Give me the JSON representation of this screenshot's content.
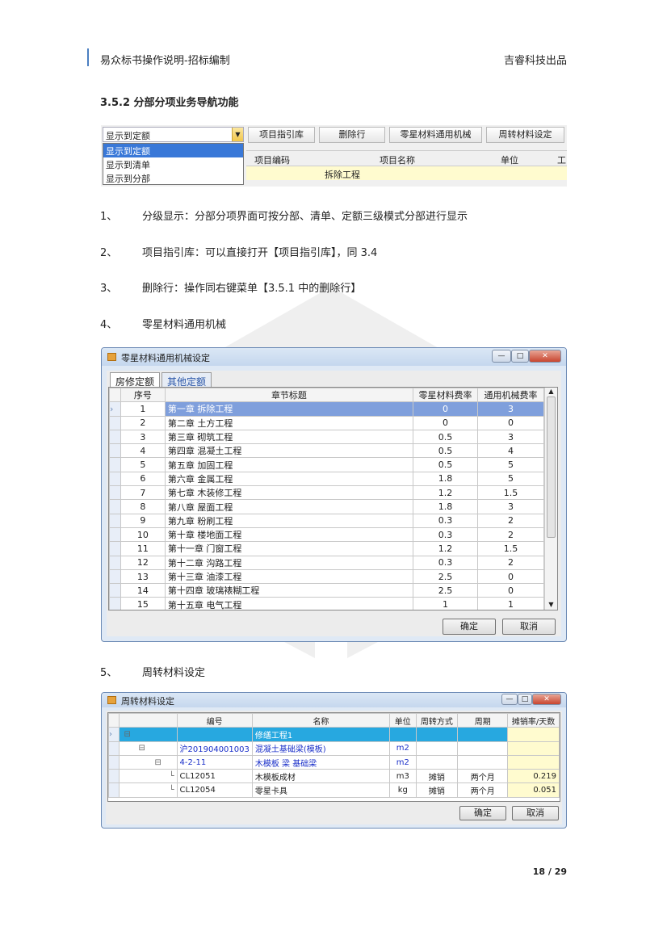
{
  "header": {
    "left": "易众标书操作说明-招标编制",
    "right": "吉睿科技出品"
  },
  "section_title": "3.5.2 分部分项业务导航功能",
  "toolbar": {
    "combo_value": "显示到定额",
    "dropdown": [
      "显示到定额",
      "显示到清单",
      "显示到分部"
    ],
    "buttons": [
      "项目指引库",
      "删除行",
      "零星材料通用机械",
      "周转材料设定"
    ],
    "headers": [
      "项目编码",
      "项目名称",
      "单位",
      "工"
    ],
    "row_name": "拆除工程"
  },
  "items": [
    {
      "n": "1、",
      "text": "分级显示：分部分项界面可按分部、清单、定额三级模式分部进行显示"
    },
    {
      "n": "2、",
      "text": "项目指引库：可以直接打开【项目指引库】，同 3.4"
    },
    {
      "n": "3、",
      "text": "删除行：操作同右键菜单【3.5.1 中的删除行】"
    },
    {
      "n": "4、",
      "text": "零星材料通用机械"
    },
    {
      "n": "5、",
      "text": "周转材料设定"
    }
  ],
  "dialog1": {
    "title": "零星材料通用机械设定",
    "tabs": [
      "房修定额",
      "其他定额"
    ],
    "columns": [
      "序号",
      "章节标题",
      "零星材料费率",
      "通用机械费率"
    ],
    "rows": [
      [
        "1",
        "第一章 拆除工程",
        "0",
        "3"
      ],
      [
        "2",
        "第二章 土方工程",
        "0",
        "0"
      ],
      [
        "3",
        "第三章 砌筑工程",
        "0.5",
        "3"
      ],
      [
        "4",
        "第四章 混凝土工程",
        "0.5",
        "4"
      ],
      [
        "5",
        "第五章 加固工程",
        "0.5",
        "5"
      ],
      [
        "6",
        "第六章 金属工程",
        "1.8",
        "5"
      ],
      [
        "7",
        "第七章 木装修工程",
        "1.2",
        "1.5"
      ],
      [
        "8",
        "第八章 屋面工程",
        "1.8",
        "3"
      ],
      [
        "9",
        "第九章 粉刷工程",
        "0.3",
        "2"
      ],
      [
        "10",
        "第十章 楼地面工程",
        "0.3",
        "2"
      ],
      [
        "11",
        "第十一章 门窗工程",
        "1.2",
        "1.5"
      ],
      [
        "12",
        "第十二章 沟路工程",
        "0.3",
        "2"
      ],
      [
        "13",
        "第十三章 油漆工程",
        "2.5",
        "0"
      ],
      [
        "14",
        "第十四章 玻璃裱糊工程",
        "2.5",
        "0"
      ],
      [
        "15",
        "第十五章 电气工程",
        "1",
        "1"
      ]
    ],
    "ok": "确定",
    "cancel": "取消"
  },
  "dialog2": {
    "title": "周转材料设定",
    "columns": [
      "编号",
      "名称",
      "单位",
      "周转方式",
      "周期",
      "摊销率/天数"
    ],
    "rows": [
      [
        "",
        "修缮工程1",
        "",
        "",
        "",
        ""
      ],
      [
        "沪201904001003",
        "混凝土基础梁(模板)",
        "m2",
        "",
        "",
        ""
      ],
      [
        "4-2-11",
        "木模板 梁 基础梁",
        "m2",
        "",
        "",
        ""
      ],
      [
        "CL12051",
        "木模板成材",
        "m3",
        "摊销",
        "两个月",
        "0.219"
      ],
      [
        "CL12054",
        "零星卡具",
        "kg",
        "摊销",
        "两个月",
        "0.051"
      ]
    ],
    "ok": "确定",
    "cancel": "取消"
  },
  "page": "18 / 29",
  "colors": {
    "accent": "#4a7fc1",
    "selection": "#3978d8",
    "tree_selection": "#27a8e0"
  }
}
